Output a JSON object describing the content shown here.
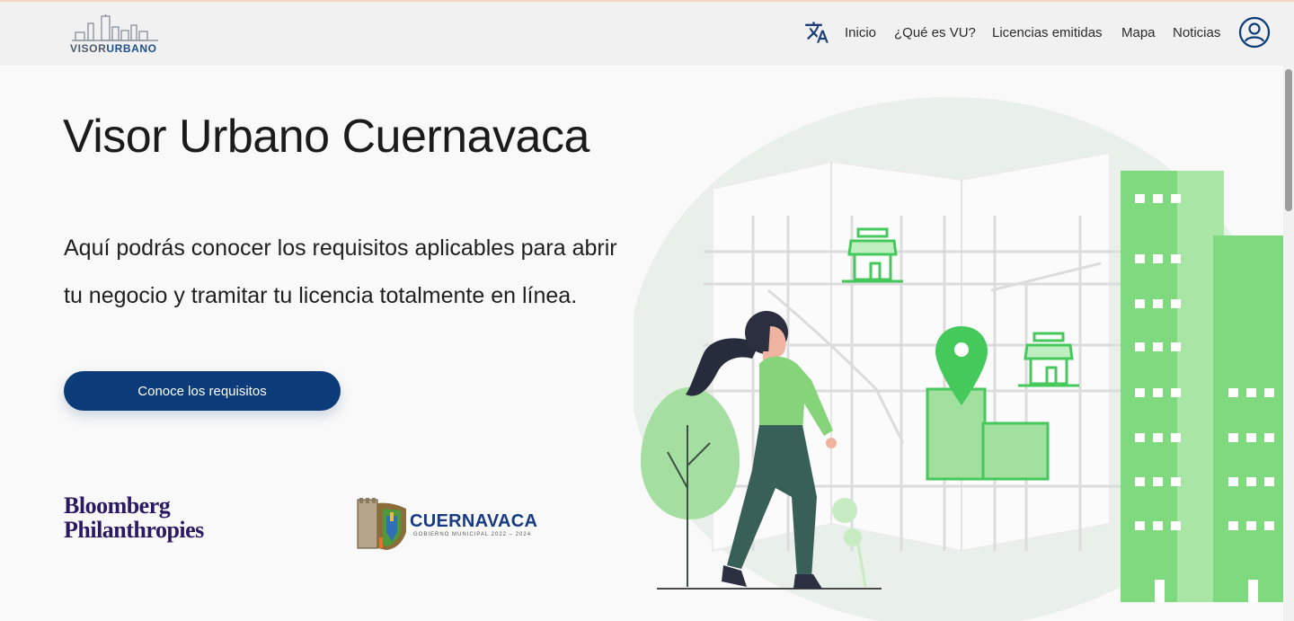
{
  "header": {
    "logo": {
      "part1": "VISOR",
      "part2": "URBANO"
    },
    "translate_icon": "translate-icon",
    "nav": [
      "Inicio",
      "¿Qué es VU?",
      "Licencias emitidas",
      "Mapa",
      "Noticias"
    ],
    "user_icon": "account-circle-icon"
  },
  "hero": {
    "title": "Visor Urbano Cuernavaca",
    "description": "Aquí podrás conocer los requisitos aplicables para abrir tu negocio y tramitar tu licencia totalmente en línea.",
    "cta_label": "Conoce los requisitos"
  },
  "partners": {
    "bloomberg_line1": "Bloomberg",
    "bloomberg_line2": "Philanthropies",
    "cuernavaca_name": "CUERNAVACA",
    "cuernavaca_sub": "GOBIERNO MUNICIPAL 2022 – 2024"
  },
  "colors": {
    "primary": "#0c3b79",
    "green": "#3fcf5a",
    "green_light": "#a4e3a4",
    "header_bg": "#f1f1f1"
  }
}
